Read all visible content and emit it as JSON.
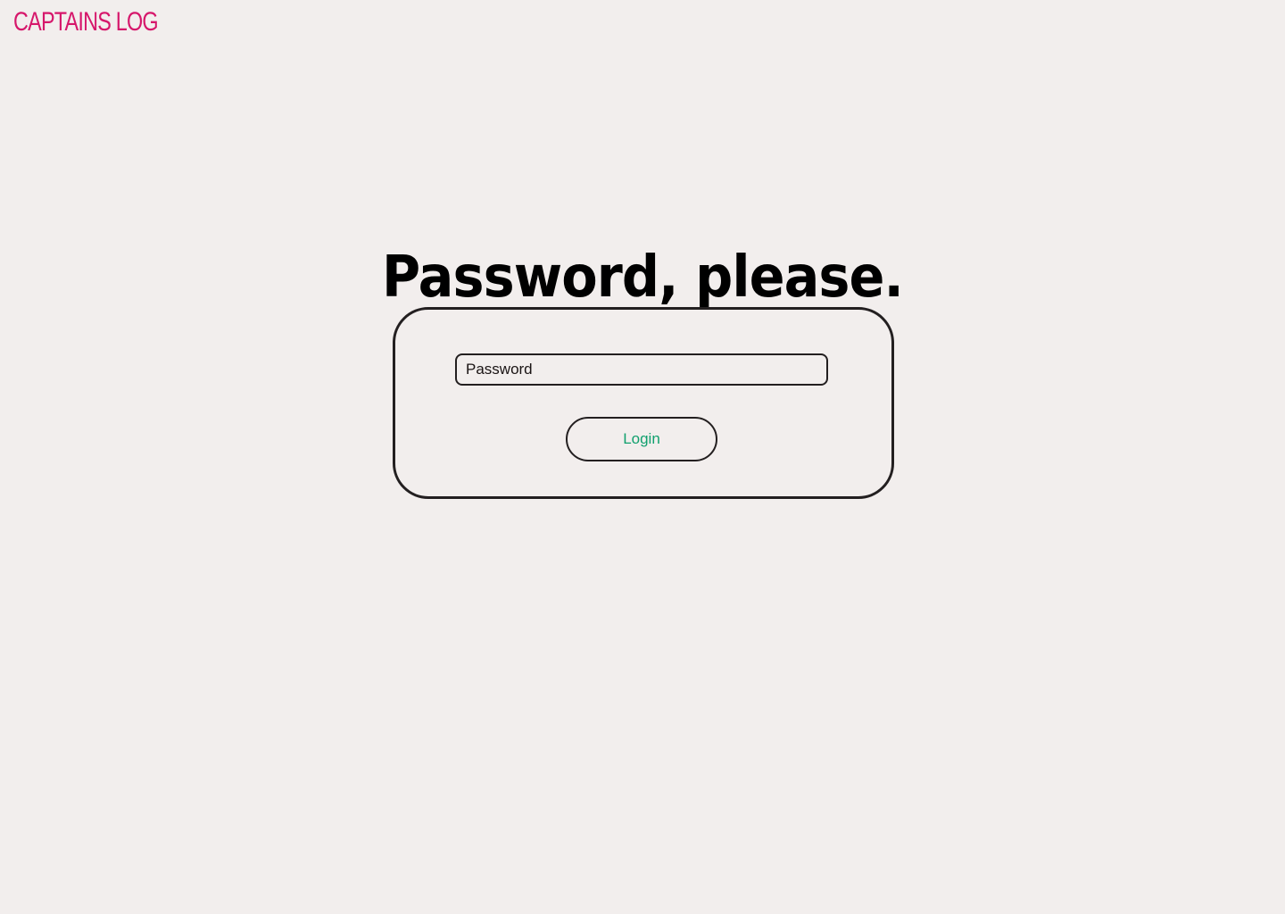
{
  "brand": {
    "title": "CAPTAINS LOG",
    "color": "#d6176b"
  },
  "login": {
    "heading": "Password, please.",
    "password_placeholder": "Password",
    "password_value": "",
    "button_label": "Login",
    "button_color": "#11a06e"
  },
  "colors": {
    "background": "#f2eeed",
    "border": "#231f20"
  }
}
